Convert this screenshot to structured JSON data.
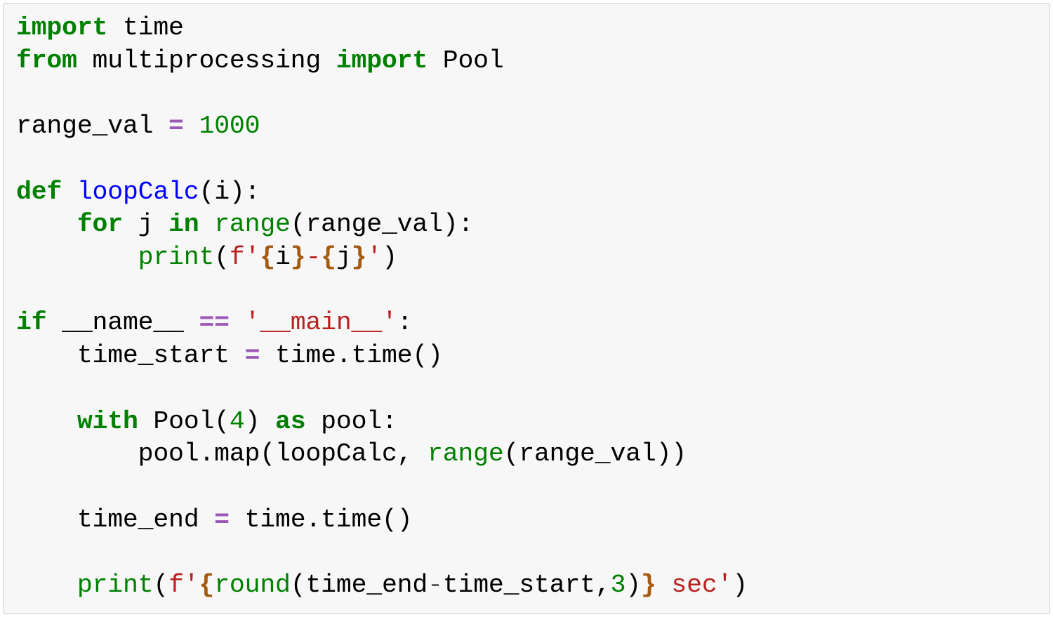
{
  "code": {
    "l1": {
      "t1": "import",
      "t2": " time"
    },
    "l2": {
      "t1": "from",
      "t2": " multiprocessing ",
      "t3": "import",
      "t4": " Pool"
    },
    "l3": "",
    "l4": {
      "t1": "range_val ",
      "t2": "=",
      "t3": " ",
      "t4": "1000"
    },
    "l5": "",
    "l6": {
      "t1": "def",
      "t2": " ",
      "t3": "loopCalc",
      "t4": "(i):"
    },
    "l7": {
      "t1": "    ",
      "t2": "for",
      "t3": " j ",
      "t4": "in",
      "t5": " ",
      "t6": "range",
      "t7": "(range_val):"
    },
    "l8": {
      "t1": "        ",
      "t2": "print",
      "t3": "(",
      "t4": "f'",
      "t5": "{",
      "t6": "i",
      "t7": "}",
      "t8": "-",
      "t9": "{",
      "t10": "j",
      "t11": "}",
      "t12": "'",
      "t13": ")"
    },
    "l9": "",
    "l10": {
      "t1": "if",
      "t2": " __name__ ",
      "t3": "==",
      "t4": " ",
      "t5": "'__main__'",
      "t6": ":"
    },
    "l11": {
      "t1": "    time_start ",
      "t2": "=",
      "t3": " time.time()"
    },
    "l12": "",
    "l13": {
      "t1": "    ",
      "t2": "with",
      "t3": " Pool(",
      "t4": "4",
      "t5": ") ",
      "t6": "as",
      "t7": " pool:"
    },
    "l14": {
      "t1": "        pool.map(loopCalc, ",
      "t2": "range",
      "t3": "(range_val))"
    },
    "l15": "",
    "l16": {
      "t1": "    time_end ",
      "t2": "=",
      "t3": " time.time()"
    },
    "l17": "",
    "l18": {
      "t1": "    ",
      "t2": "print",
      "t3": "(",
      "t4": "f'",
      "t5": "{",
      "t6": "round",
      "t7": "(time_end",
      "t8": "-",
      "t9": "time_start,",
      "t10": "3",
      "t11": ")",
      "t12": "}",
      "t13": " sec",
      "t14": "'",
      "t15": ")"
    }
  }
}
